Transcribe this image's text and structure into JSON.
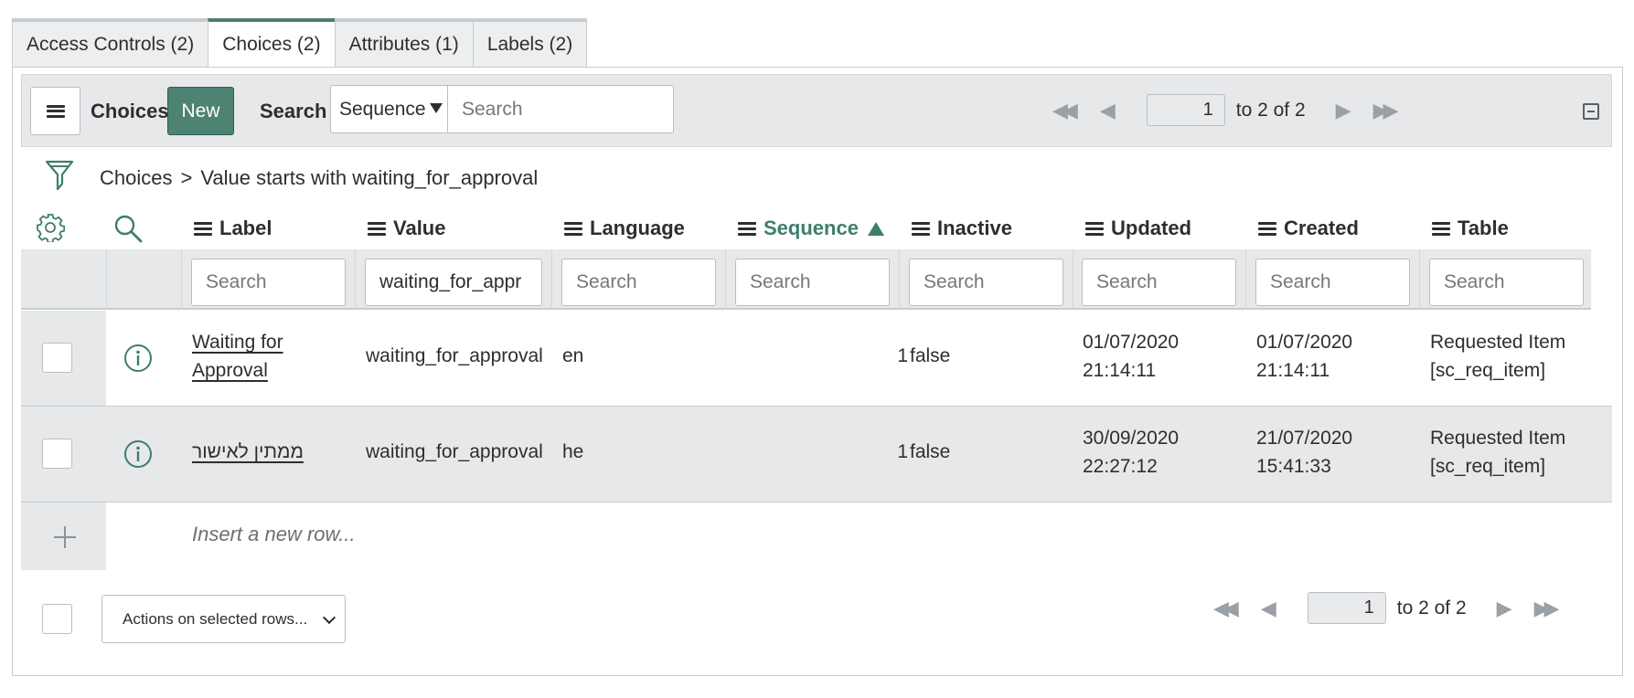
{
  "tabs": [
    {
      "label": "Access Controls (2)"
    },
    {
      "label": "Choices (2)"
    },
    {
      "label": "Attributes (1)"
    },
    {
      "label": "Labels (2)"
    }
  ],
  "toolbar": {
    "title": "Choices",
    "new_label": "New",
    "search_label": "Search",
    "search_field": "Sequence",
    "search_placeholder": "Search"
  },
  "pager": {
    "page": "1",
    "range_text": "to 2 of 2"
  },
  "breadcrumb": {
    "root": "Choices",
    "separator": ">",
    "condition": "Value starts with waiting_for_approval"
  },
  "columns": [
    {
      "label": "Label",
      "search": "Search",
      "filter": ""
    },
    {
      "label": "Value",
      "search": "Search",
      "filter": "waiting_for_appr"
    },
    {
      "label": "Language",
      "search": "Search",
      "filter": ""
    },
    {
      "label": "Sequence",
      "search": "Search",
      "filter": ""
    },
    {
      "label": "Inactive",
      "search": "Search",
      "filter": ""
    },
    {
      "label": "Updated",
      "search": "Search",
      "filter": ""
    },
    {
      "label": "Created",
      "search": "Search",
      "filter": ""
    },
    {
      "label": "Table",
      "search": "Search",
      "filter": ""
    }
  ],
  "sorted_column": "Sequence",
  "rows": [
    {
      "label_line1": "Waiting for",
      "label_line2": "Approval",
      "value": "waiting_for_approval",
      "language": "en",
      "sequence": "1",
      "inactive": "false",
      "updated_date": "01/07/2020",
      "updated_time": "21:14:11",
      "created_date": "01/07/2020",
      "created_time": "21:14:11",
      "table_line1": "Requested Item",
      "table_line2": "[sc_req_item]"
    },
    {
      "label_line1": "ממתין לאישור",
      "label_line2": "",
      "value": "waiting_for_approval",
      "language": "he",
      "sequence": "1",
      "inactive": "false",
      "updated_date": "30/09/2020",
      "updated_time": "22:27:12",
      "created_date": "21/07/2020",
      "created_time": "15:41:33",
      "table_line1": "Requested Item",
      "table_line2": "[sc_req_item]"
    }
  ],
  "insert_row_text": "Insert a new row...",
  "footer": {
    "actions_label": "Actions on selected rows..."
  },
  "colors": {
    "accent": "#4e8273",
    "sorted_header": "#3f7d6e",
    "toolbar_bg": "#e6e8ea"
  }
}
